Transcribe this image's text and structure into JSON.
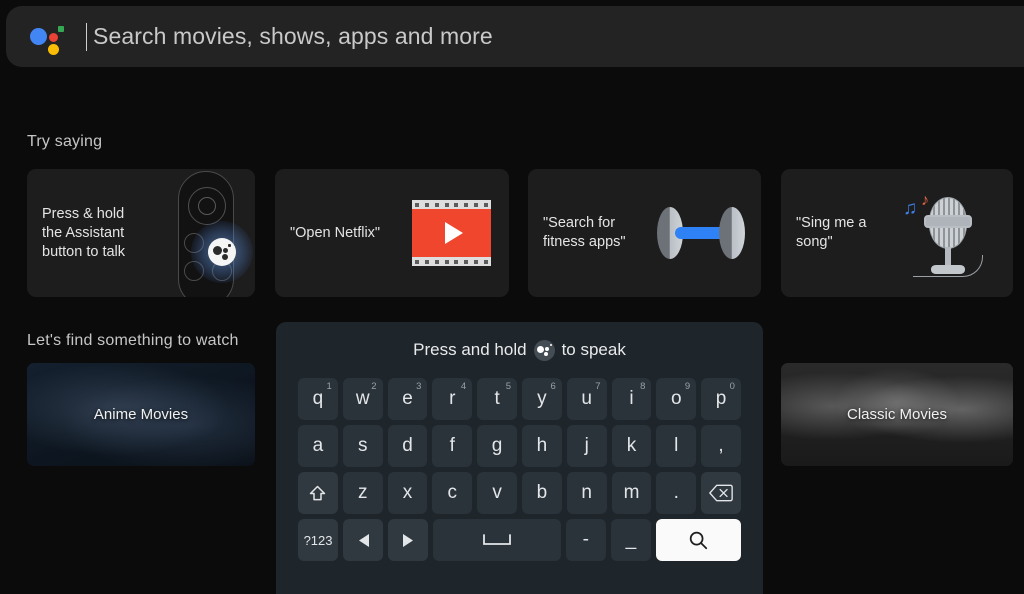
{
  "search": {
    "placeholder": "Search movies, shows, apps and more",
    "value": "",
    "assistant_icon": "google-assistant-icon"
  },
  "try_saying": {
    "title": "Try saying",
    "cards": [
      {
        "text": "Press & hold\nthe Assistant\nbutton to talk",
        "art": "tv-remote-assistant-button-icon"
      },
      {
        "text": "\"Open Netflix\"",
        "art": "film-strip-play-icon"
      },
      {
        "text": "\"Search for\nfitness apps\"",
        "art": "dumbbell-icon"
      },
      {
        "text": "\"Sing me a\nsong\"",
        "art": "microphone-music-notes-icon"
      }
    ]
  },
  "watch": {
    "title": "Let's find something to watch",
    "tiles": [
      {
        "label": "Anime Movies"
      },
      {
        "label": "Classic Movies"
      }
    ]
  },
  "keyboard": {
    "hint_before": "Press and hold",
    "hint_after": "to speak",
    "hint_icon": "google-assistant-icon",
    "rows": [
      [
        {
          "label": "q",
          "sup": "1"
        },
        {
          "label": "w",
          "sup": "2"
        },
        {
          "label": "e",
          "sup": "3"
        },
        {
          "label": "r",
          "sup": "4"
        },
        {
          "label": "t",
          "sup": "5"
        },
        {
          "label": "y",
          "sup": "6"
        },
        {
          "label": "u",
          "sup": "7"
        },
        {
          "label": "i",
          "sup": "8"
        },
        {
          "label": "o",
          "sup": "9"
        },
        {
          "label": "p",
          "sup": "0"
        }
      ],
      [
        {
          "label": "a"
        },
        {
          "label": "s"
        },
        {
          "label": "d"
        },
        {
          "label": "f"
        },
        {
          "label": "g"
        },
        {
          "label": "h"
        },
        {
          "label": "j"
        },
        {
          "label": "k"
        },
        {
          "label": "l"
        },
        {
          "label": ","
        }
      ],
      [
        {
          "label": "",
          "icon": "shift-icon"
        },
        {
          "label": "z"
        },
        {
          "label": "x"
        },
        {
          "label": "c"
        },
        {
          "label": "v"
        },
        {
          "label": "b"
        },
        {
          "label": "n"
        },
        {
          "label": "m"
        },
        {
          "label": "."
        },
        {
          "label": "",
          "icon": "backspace-icon"
        }
      ],
      [
        {
          "label": "?123"
        },
        {
          "label": "",
          "icon": "arrow-left-icon"
        },
        {
          "label": "",
          "icon": "arrow-right-icon"
        },
        {
          "label": "",
          "icon": "space-icon"
        },
        {
          "label": "-"
        },
        {
          "label": "_"
        },
        {
          "label": "",
          "icon": "search-icon"
        }
      ]
    ]
  },
  "colors": {
    "page_background": "#0b0b0b",
    "search_bar": "#232323",
    "card": "#1d1d1d",
    "keyboard_panel": "#1e252b",
    "key": "#2a323a",
    "key_modifier": "#313940",
    "search_key": "#fafafa",
    "assistant_blue": "#4285f4",
    "assistant_red": "#ea4335",
    "assistant_yellow": "#fbbc05",
    "assistant_green": "#34a853",
    "netflix_red": "#f0462d",
    "dumbbell_blue": "#2f82f5"
  }
}
